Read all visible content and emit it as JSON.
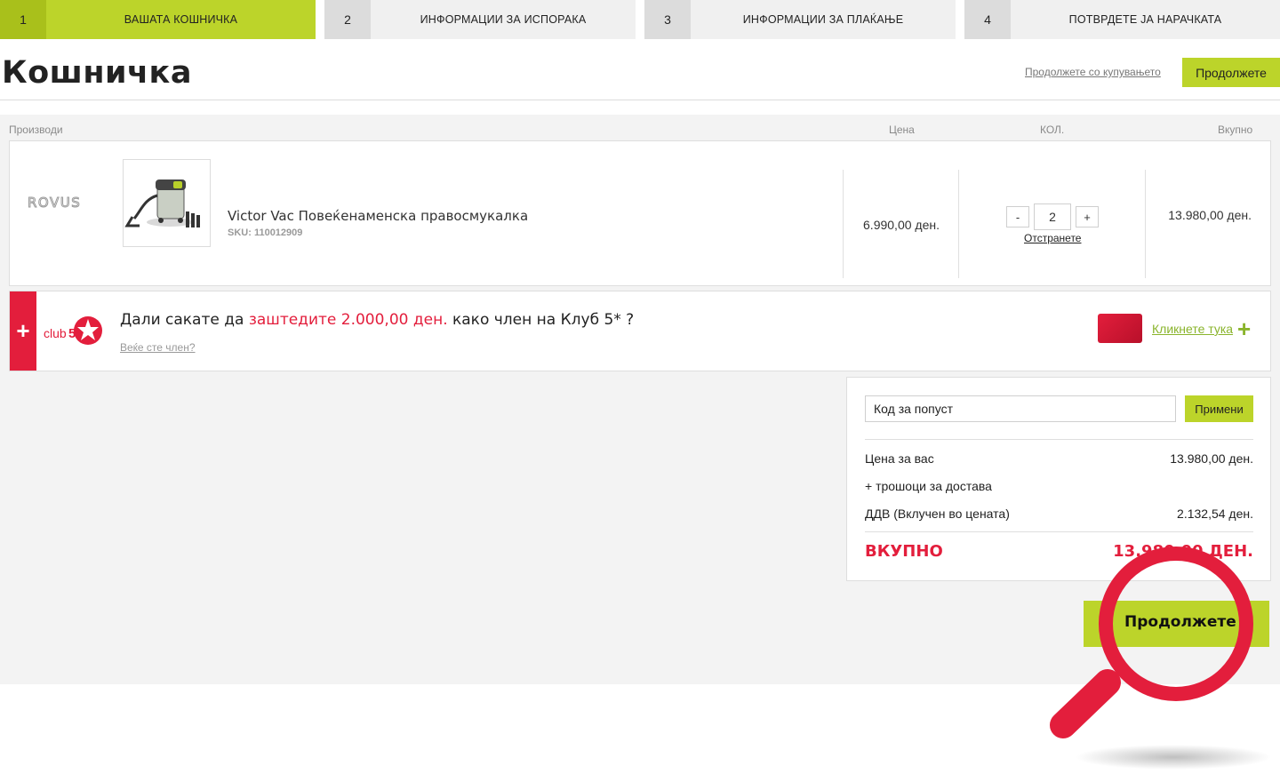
{
  "steps": [
    {
      "num": "1",
      "label": "ВАШАТА КОШНИЧКА"
    },
    {
      "num": "2",
      "label": "ИНФОРМАЦИИ ЗА ИСПОРАКА"
    },
    {
      "num": "3",
      "label": "ИНФОРМАЦИИ ЗА ПЛАЌАЊЕ"
    },
    {
      "num": "4",
      "label": "ПОТВРДЕТЕ ЈА НАРАЧКАТА"
    }
  ],
  "header": {
    "title": "Кошничка",
    "continue_shopping": "Продолжете со купувањето",
    "continue_label": "Продолжете"
  },
  "columns": {
    "products": "Производи",
    "price": "Цена",
    "qty": "КОЛ.",
    "total": "Вкупно"
  },
  "product": {
    "brand": "ROVUS",
    "name": "Victor Vac Повеќенаменска правосмукалка",
    "sku": "SKU: 110012909",
    "unit_price": "6.990,00 ден.",
    "qty_minus": "-",
    "qty_value": "2",
    "qty_plus": "+",
    "remove": "Отстранете",
    "line_total": "13.980,00 ден."
  },
  "club": {
    "plus": "+",
    "question_before": "Дали сакате да ",
    "question_save": "заштедите 2.000,00 ден.",
    "question_after": " како член на Клуб 5* ?",
    "member_link": "Веќе сте член?",
    "click_here": "Кликнете тука",
    "green_plus": "+"
  },
  "summary": {
    "coupon_placeholder": "Код за попуст",
    "apply": "Примени",
    "your_price_label": "Цена за вас",
    "your_price_value": "13.980,00 ден.",
    "shipping_label": "+ трошоци за достава",
    "vat_label": "ДДВ (Вклучен во цената)",
    "vat_value": "2.132,54 ден.",
    "total_label": "ВКУПНО",
    "total_value": "13.980,00 ДЕН."
  },
  "bottom": {
    "continue_label": "Продолжете"
  },
  "colors": {
    "accent_green": "#bcd42a",
    "accent_red": "#e31e3c",
    "link_green": "#8ab42c"
  }
}
